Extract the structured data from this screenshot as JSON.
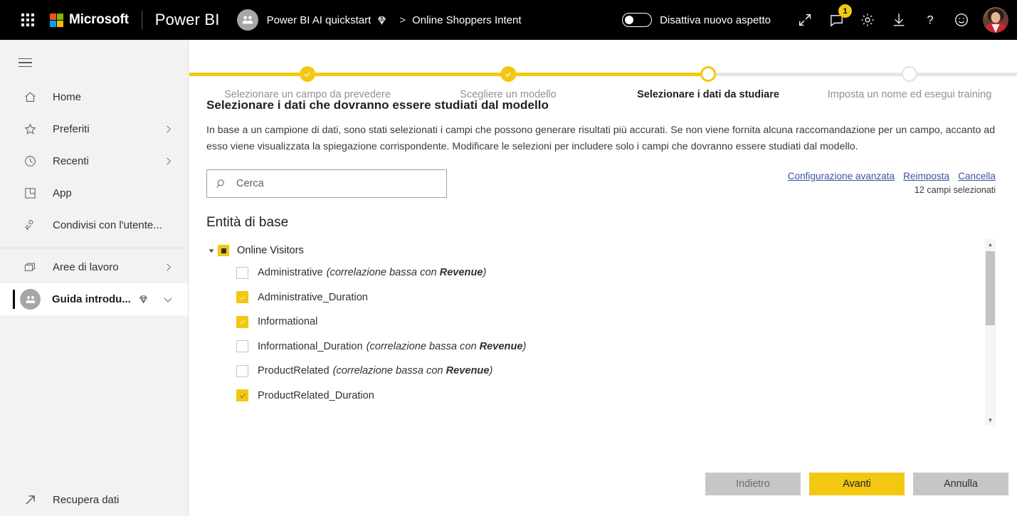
{
  "topbar": {
    "waffle_label": "app-launcher",
    "microsoft_label": "Microsoft",
    "product_title": "Power BI",
    "workspace": "Power BI AI quickstart",
    "breadcrumb_separator": ">",
    "item": "Online Shoppers Intent",
    "toggle_label": "Disattiva nuovo aspetto",
    "notification_count": "1",
    "icons": [
      "expand-icon",
      "feedback-icon",
      "settings-icon",
      "download-icon",
      "help-icon",
      "smiley-icon",
      "user-avatar"
    ]
  },
  "sidebar": {
    "items": [
      {
        "label": "Home",
        "icon": "home-icon",
        "chevron": false
      },
      {
        "label": "Preferiti",
        "icon": "star-icon",
        "chevron": true
      },
      {
        "label": "Recenti",
        "icon": "clock-icon",
        "chevron": true
      },
      {
        "label": "App",
        "icon": "apps-icon",
        "chevron": false
      },
      {
        "label": "Condivisi con l'utente...",
        "icon": "shared-with-me-icon",
        "chevron": false
      }
    ],
    "group2": [
      {
        "label": "Aree di lavoro",
        "icon": "workspaces-icon",
        "chevron": true
      }
    ],
    "selected": {
      "label": "Guida introdu...",
      "icon": "workspace-avatar-icon",
      "badge_icon": "diamond-icon",
      "chevron_icon": "chevron-down-icon"
    },
    "bottom": {
      "label": "Recupera dati",
      "icon": "get-data-icon"
    }
  },
  "stepper": {
    "steps": [
      {
        "label": "Selezionare un campo da prevedere",
        "state": "done"
      },
      {
        "label": "Scegliere un modello",
        "state": "done"
      },
      {
        "label": "Selezionare i dati da studiare",
        "state": "current"
      },
      {
        "label": "Imposta un nome ed esegui training",
        "state": "todo"
      }
    ],
    "accent": "#f2c811",
    "track": "#e6e6e6"
  },
  "page": {
    "heading": "Selezionare i dati che dovranno essere studiati dal modello",
    "description": "In base a un campione di dati, sono stati selezionati i campi che possono generare risultati più accurati. Se non viene fornita alcuna raccomandazione per un campo, accanto ad esso viene visualizzata la spiegazione corrispondente. Modificare le selezioni per includere solo i campi che dovranno essere studiati dal modello."
  },
  "search": {
    "placeholder": "Cerca",
    "value": "",
    "icon": "search-icon"
  },
  "links": {
    "advanced": "Configurazione avanzata",
    "reset": "Reimposta",
    "clear": "Cancella",
    "selected_count": "12 campi selezionati",
    "link_color": "#3a53a4"
  },
  "fields": {
    "section_title": "Entità di base",
    "root": {
      "label": "Online Visitors",
      "state": "partial",
      "expanded": true
    },
    "rows": [
      {
        "label": "Administrative",
        "checked": false,
        "note": "(correlazione bassa con ",
        "note_bold": "Revenue",
        "note_end": ")"
      },
      {
        "label": "Administrative_Duration",
        "checked": true,
        "note": "",
        "note_bold": "",
        "note_end": ""
      },
      {
        "label": "Informational",
        "checked": true,
        "note": "",
        "note_bold": "",
        "note_end": ""
      },
      {
        "label": "Informational_Duration",
        "checked": false,
        "note": "(correlazione bassa con ",
        "note_bold": "Revenue",
        "note_end": ")"
      },
      {
        "label": "ProductRelated",
        "checked": false,
        "note": "(correlazione bassa con ",
        "note_bold": "Revenue",
        "note_end": ")"
      },
      {
        "label": "ProductRelated_Duration",
        "checked": true,
        "note": "",
        "note_bold": "",
        "note_end": ""
      }
    ]
  },
  "footer": {
    "back": "Indietro",
    "next": "Avanti",
    "cancel": "Annulla"
  }
}
